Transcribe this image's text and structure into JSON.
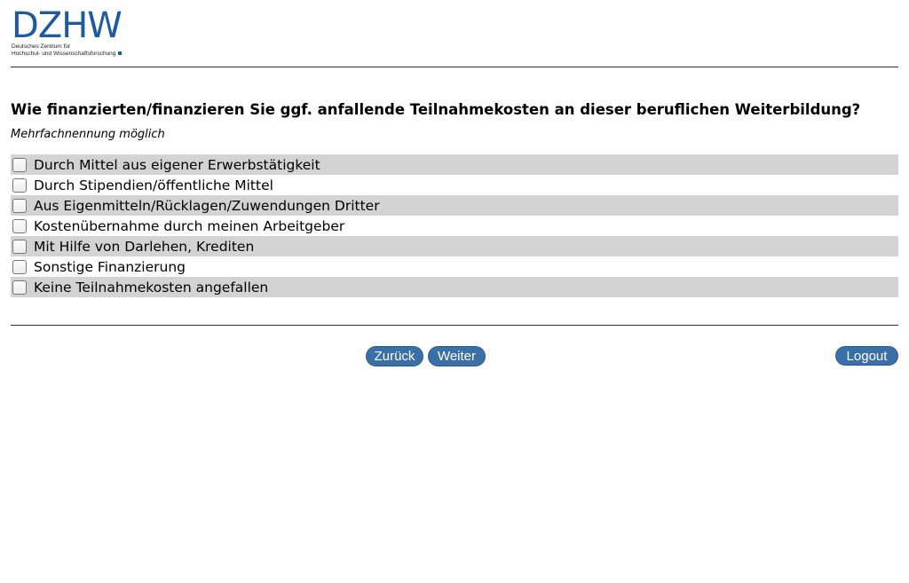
{
  "logo": {
    "wordmark": "DZHW",
    "line1": "Deutsches Zentrum für",
    "line2": "Hochschul- und Wissenschaftsforschung",
    "brand_color": "#1e5aa0"
  },
  "question": {
    "text": "Wie finanzierten/finanzieren Sie ggf. anfallende Teilnahmekosten an dieser beruflichen Weiterbildung?",
    "instruction": "Mehrfachnennung möglich"
  },
  "options": [
    {
      "label": "Durch Mittel aus eigener Erwerbstätigkeit",
      "checked": false
    },
    {
      "label": "Durch Stipendien/öffentliche Mittel",
      "checked": false
    },
    {
      "label": "Aus Eigenmitteln/Rücklagen/Zuwendungen Dritter",
      "checked": false
    },
    {
      "label": "Kostenübernahme durch meinen Arbeitgeber",
      "checked": false
    },
    {
      "label": "Mit Hilfe von Darlehen, Krediten",
      "checked": false
    },
    {
      "label": "Sonstige Finanzierung",
      "checked": false
    },
    {
      "label": "Keine Teilnahmekosten angefallen",
      "checked": false
    }
  ],
  "navigation": {
    "back_label": "Zurück",
    "next_label": "Weiter",
    "logout_label": "Logout",
    "button_color": "#3a6fa8"
  }
}
